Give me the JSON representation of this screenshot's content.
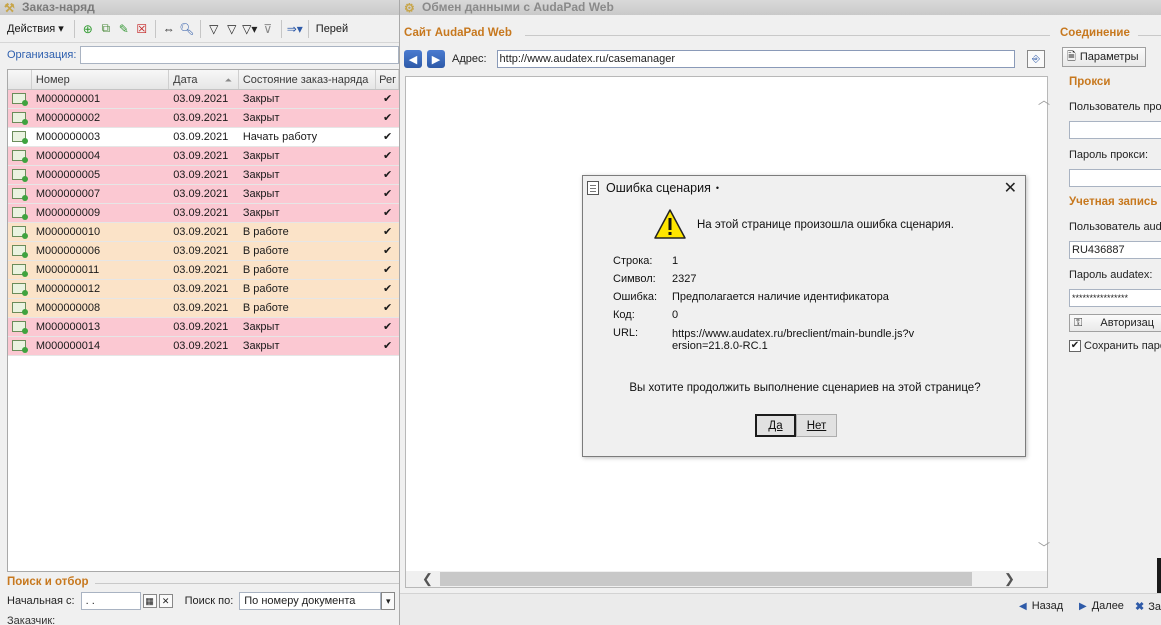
{
  "left": {
    "title": "Заказ-наряд",
    "toolbar": {
      "actions_label": "Действия",
      "goto_label": "Перей"
    },
    "org_label": "Организация:",
    "columns": [
      "Номер",
      "Дата",
      "Состояние заказ-наряда",
      "Рег"
    ],
    "rows": [
      {
        "num": "M000000001",
        "date": "03.09.2021",
        "state": "Закрыт",
        "status": "closed"
      },
      {
        "num": "M000000002",
        "date": "03.09.2021",
        "state": "Закрыт",
        "status": "closed"
      },
      {
        "num": "M000000003",
        "date": "03.09.2021",
        "state": "Начать работу",
        "status": "start"
      },
      {
        "num": "M000000004",
        "date": "03.09.2021",
        "state": "Закрыт",
        "status": "closed"
      },
      {
        "num": "M000000005",
        "date": "03.09.2021",
        "state": "Закрыт",
        "status": "closed"
      },
      {
        "num": "M000000007",
        "date": "03.09.2021",
        "state": "Закрыт",
        "status": "closed"
      },
      {
        "num": "M000000009",
        "date": "03.09.2021",
        "state": "Закрыт",
        "status": "closed"
      },
      {
        "num": "M000000010",
        "date": "03.09.2021",
        "state": "В работе",
        "status": "working"
      },
      {
        "num": "M000000006",
        "date": "03.09.2021",
        "state": "В работе",
        "status": "working"
      },
      {
        "num": "M000000011",
        "date": "03.09.2021",
        "state": "В работе",
        "status": "working"
      },
      {
        "num": "M000000012",
        "date": "03.09.2021",
        "state": "В работе",
        "status": "working"
      },
      {
        "num": "M000000008",
        "date": "03.09.2021",
        "state": "В работе",
        "status": "working"
      },
      {
        "num": "M000000013",
        "date": "03.09.2021",
        "state": "Закрыт",
        "status": "closed"
      },
      {
        "num": "M000000014",
        "date": "03.09.2021",
        "state": "Закрыт",
        "status": "closed"
      }
    ],
    "search": {
      "title": "Поиск и отбор",
      "start_label": "Начальная с:",
      "start_value": ". .",
      "search_by_label": "Поиск по:",
      "search_by_value": "По номеру документа",
      "customer_label": "Заказчик:"
    }
  },
  "right": {
    "title": "Обмен данными с AudaPad Web",
    "section_title": "Сайт AudaPad Web",
    "address_label": "Адрес:",
    "address_value": "http://www.audatex.ru/casemanager",
    "connection_title": "Соединение",
    "params_label": "Параметры",
    "proxy_title": "Прокси",
    "proxy_user_label": "Пользователь прок",
    "proxy_password_label": "Пароль прокси:",
    "account_title": "Учетная запись",
    "audatex_user_label": "Пользователь aud",
    "audatex_user_value": "RU436887",
    "audatex_password_label": "Пароль audatex:",
    "audatex_password_value": "****************",
    "auth_label": "Авторизац",
    "save_password_label": "Сохранить паро",
    "back_label": "Назад",
    "next_label": "Далее",
    "close_label": "За"
  },
  "dialog": {
    "title": "Ошибка сценария",
    "message": "На этой странице произошла ошибка сценария.",
    "line_label": "Строка:",
    "line_value": "1",
    "char_label": "Символ:",
    "char_value": "2327",
    "error_label": "Ошибка:",
    "error_value": "Предполагается наличие идентификатора",
    "code_label": "Код:",
    "code_value": "0",
    "url_label": "URL:",
    "url_value": "https://www.audatex.ru/breclient/main-bundle.js?version=21.8.0-RC.1",
    "question": "Вы хотите продолжить выполнение сценариев на этой странице?",
    "yes_label": "Да",
    "no_label": "Нет"
  },
  "colors": {
    "closed_row": "#fbc8d2",
    "working_row": "#fbe3c8",
    "section_title": "#c7781e",
    "link_blue": "#2e5aa8"
  },
  "icons": [
    "settings-wrench-icon",
    "add-icon",
    "copy-icon",
    "edit-icon",
    "delete-icon",
    "swap-icon",
    "find-icon",
    "filter-icon",
    "warning-icon",
    "page-icon",
    "close-icon"
  ]
}
